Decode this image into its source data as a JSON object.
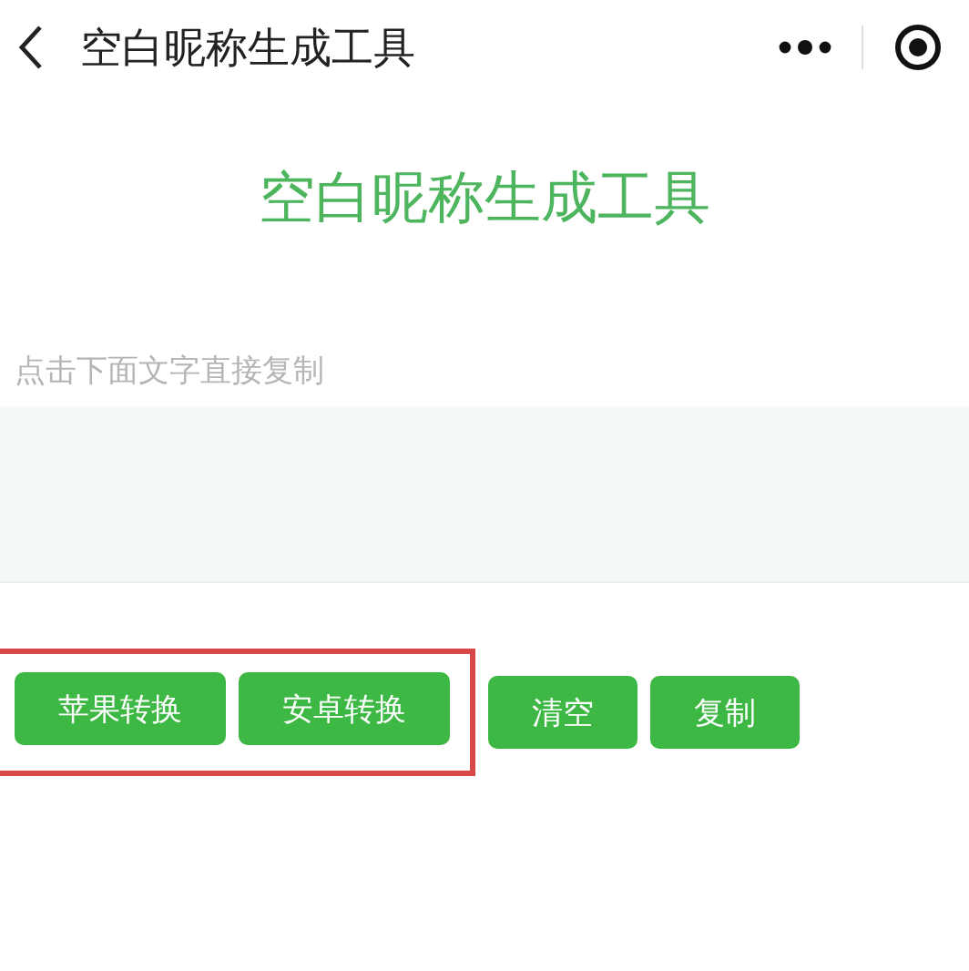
{
  "nav_bar": {
    "title": "空白昵称生成工具"
  },
  "heading": "空白昵称生成工具",
  "hint": "点击下面文字直接复制",
  "annotated_buttons": [
    "苹果转换",
    "安卓转换"
  ],
  "buttons": [
    "清空",
    "复制"
  ]
}
